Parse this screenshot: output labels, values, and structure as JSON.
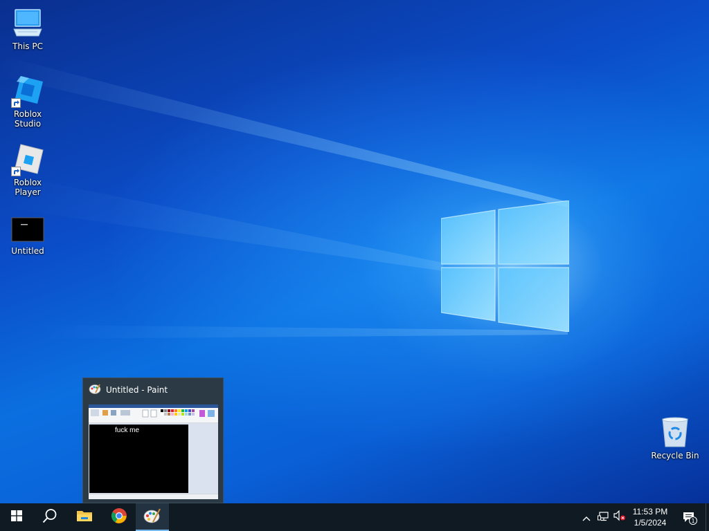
{
  "desktop": {
    "icons": [
      {
        "label": "This PC",
        "icon": "this-pc-icon"
      },
      {
        "label": "Roblox Studio",
        "icon": "roblox-studio-icon"
      },
      {
        "label": "Roblox Player",
        "icon": "roblox-player-icon"
      },
      {
        "label": "Untitled",
        "icon": "image-file-icon"
      },
      {
        "label": "Recycle Bin",
        "icon": "recycle-bin-icon"
      }
    ],
    "wallpaper_accent": "#0b6fe0"
  },
  "preview": {
    "title": "Untitled - Paint",
    "canvas_text": "fuck me"
  },
  "taskbar": {
    "buttons": [
      {
        "name": "start",
        "icon": "windows-start-icon"
      },
      {
        "name": "search",
        "icon": "search-icon"
      },
      {
        "name": "file-explorer",
        "icon": "folder-icon"
      },
      {
        "name": "chrome",
        "icon": "chrome-icon"
      },
      {
        "name": "paint",
        "icon": "paint-icon",
        "active": true
      }
    ],
    "tray": {
      "icons": [
        "chevron-up-icon",
        "network-icon",
        "volume-muted-icon"
      ],
      "time": "11:53 PM",
      "date": "1/5/2024",
      "notification_count": "1"
    },
    "background": "#0f1a23"
  }
}
